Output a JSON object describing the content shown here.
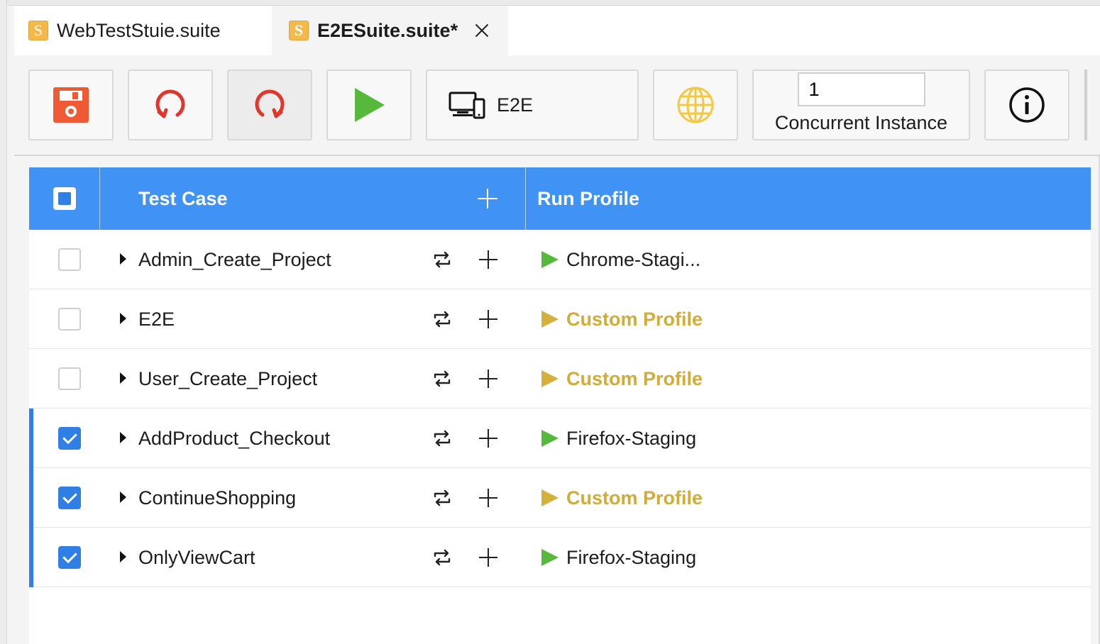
{
  "tabs": [
    {
      "label": "WebTestStuie.suite",
      "icon": "suite-icon",
      "icon_letter": "S",
      "active": true
    },
    {
      "label": "E2ESuite.suite*",
      "icon": "suite-icon",
      "icon_letter": "S",
      "active": false,
      "closable": true
    }
  ],
  "toolbar": {
    "save_icon": "save-icon",
    "reload_icon": "reload-icon",
    "refresh_icon": "refresh-icon",
    "run_icon": "run-icon",
    "environment_label": "E2E",
    "environment_icon": "devices-icon",
    "globe_icon": "globe-icon",
    "concurrent_value": "1",
    "concurrent_label": "Concurrent Instance",
    "info_icon": "info-icon"
  },
  "table": {
    "columns": {
      "test_case": "Test Case",
      "run_profile": "Run Profile"
    },
    "header_checkbox": "partial",
    "rows": [
      {
        "name": "Admin_Create_Project",
        "checked": false,
        "profile": "Chrome-Stagi...",
        "profile_type": "named"
      },
      {
        "name": "E2E",
        "checked": false,
        "profile": "Custom Profile",
        "profile_type": "custom"
      },
      {
        "name": "User_Create_Project",
        "checked": false,
        "profile": "Custom Profile",
        "profile_type": "custom"
      },
      {
        "name": "AddProduct_Checkout",
        "checked": true,
        "profile": "Firefox-Staging",
        "profile_type": "named"
      },
      {
        "name": "ContinueShopping",
        "checked": true,
        "profile": "Custom Profile",
        "profile_type": "custom"
      },
      {
        "name": "OnlyViewCart",
        "checked": true,
        "profile": "Firefox-Staging",
        "profile_type": "named"
      }
    ]
  },
  "colors": {
    "header_blue": "#4092f4",
    "selected_blue": "#2f7fe5",
    "play_green": "#56b93b",
    "custom_gold": "#d1ad38",
    "save_orange": "#ef5a34",
    "reload_red": "#e0362c",
    "globe_yellow": "#f5c842"
  }
}
